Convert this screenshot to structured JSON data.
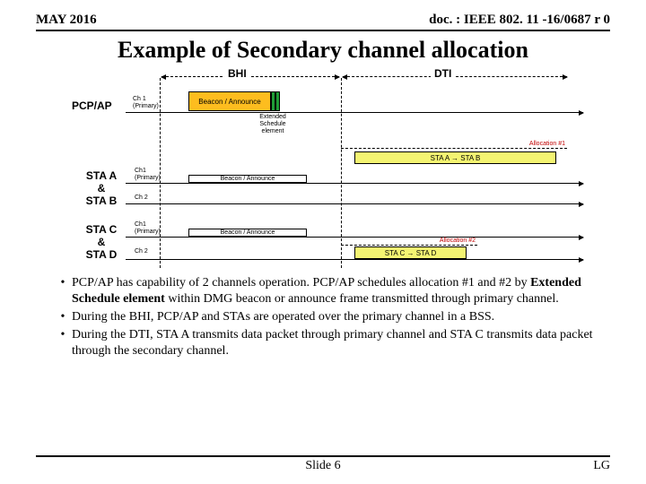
{
  "header": {
    "date": "MAY 2016",
    "doc": "doc. : IEEE 802. 11 -16/0687 r 0"
  },
  "title": "Example of Secondary channel allocation",
  "diagram": {
    "sections": {
      "bhi": "BHI",
      "dti": "DTI"
    },
    "rows": {
      "pcpap": {
        "label": "PCP/AP",
        "ch1": "Ch 1\n(Primary)"
      },
      "staab": {
        "label1": "STA A",
        "amp": "&",
        "label2": "STA B",
        "ch1": "Ch1\n(Primary)",
        "ch2": "Ch 2"
      },
      "stacd": {
        "label1": "STA C",
        "amp": "&",
        "label2": "STA D",
        "ch1": "Ch1\n(Primary)",
        "ch2": "Ch 2"
      }
    },
    "beacon": "Beacon / Announce",
    "extended": "Extended\nSchedule\nelement",
    "alloc1": {
      "label": "Allocation #1",
      "text": "STA A → STA B"
    },
    "alloc2": {
      "label": "Allocation #2",
      "text": "STA C → STA D"
    }
  },
  "bullets": [
    {
      "text_parts": [
        "PCP/AP has capability of 2 channels operation. PCP/AP schedules allocation #1 and #2 by ",
        {
          "bold": "Extended Schedule element"
        },
        " within DMG beacon or announce frame transmitted through primary channel."
      ]
    },
    {
      "text_parts": [
        "During the BHI, PCP/AP and STAs are operated over the primary channel in a BSS."
      ]
    },
    {
      "text_parts": [
        "During the DTI, STA A transmits data packet through primary channel and STA C transmits data packet through the secondary channel."
      ]
    }
  ],
  "footer": {
    "slide": "Slide 6",
    "author": "LG"
  }
}
